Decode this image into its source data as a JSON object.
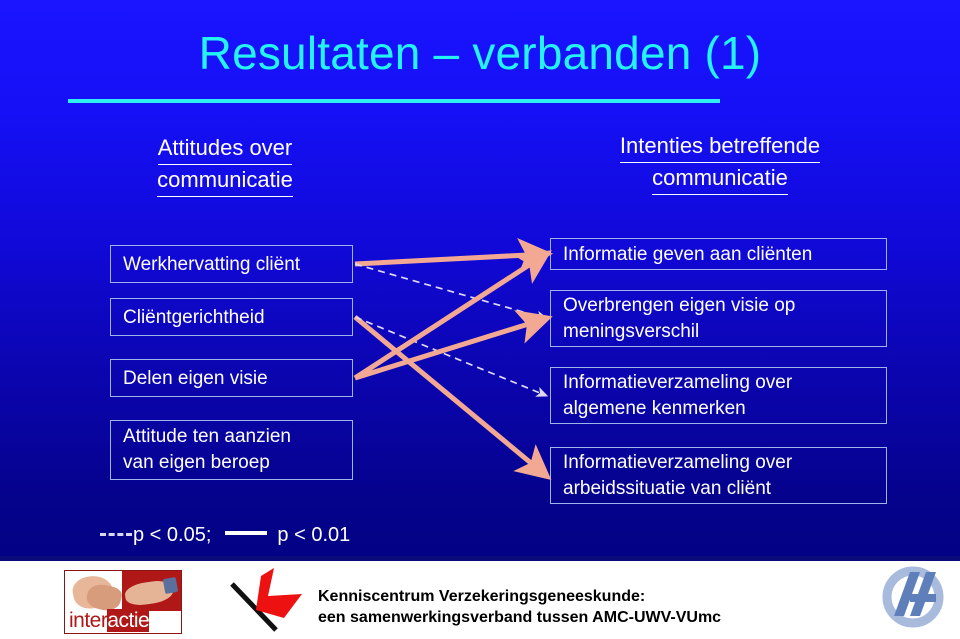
{
  "slide": {
    "title": "Resultaten – verbanden (1)",
    "title_color": "#25f3f3",
    "background_top_color": "#1a14ff",
    "background_bottom_color": "#000078"
  },
  "columns": {
    "left": {
      "heading_line1": "Attitudes over",
      "heading_line2": "communicatie",
      "boxes": [
        {
          "id": "werkhervatting",
          "text": "Werkhervatting cliënt"
        },
        {
          "id": "clientgerichtheid",
          "text": "Cliëntgerichtheid"
        },
        {
          "id": "delen-eigen-visie",
          "text": "Delen eigen visie"
        },
        {
          "id": "attitude-eigen-beroep",
          "line1": "Attitude ten aanzien",
          "line2": "van eigen beroep"
        }
      ]
    },
    "right": {
      "heading_line1": "Intenties betreffende",
      "heading_line2": "communicatie",
      "boxes": [
        {
          "id": "informatie-geven",
          "text": "Informatie geven aan cliënten"
        },
        {
          "id": "overbrengen-visie",
          "line1": "Overbrengen eigen visie op",
          "line2": "meningsverschil"
        },
        {
          "id": "verzameling-algemeen",
          "line1": "Informatieverzameling over",
          "line2": "algemene kenmerken"
        },
        {
          "id": "verzameling-arbeid",
          "line1": "Informatieverzameling over",
          "line2": "arbeidssituatie van cliënt"
        }
      ]
    }
  },
  "connections": {
    "solid_color": "#f2a893",
    "dashed_color": "#ded9f2",
    "links": [
      {
        "from": "werkhervatting",
        "to": "informatie-geven",
        "style": "solid",
        "significance": "p < 0.01"
      },
      {
        "from": "werkhervatting",
        "to": "overbrengen-visie",
        "style": "dashed",
        "significance": "p < 0.05"
      },
      {
        "from": "clientgerichtheid",
        "to": "verzameling-arbeid",
        "style": "solid",
        "significance": "p < 0.01"
      },
      {
        "from": "clientgerichtheid",
        "to": "verzameling-algemeen",
        "style": "dashed",
        "significance": "p < 0.05"
      },
      {
        "from": "delen-eigen-visie",
        "to": "informatie-geven",
        "style": "solid",
        "significance": "p < 0.01"
      },
      {
        "from": "delen-eigen-visie",
        "to": "overbrengen-visie",
        "style": "solid",
        "significance": "p < 0.01"
      }
    ]
  },
  "legend": {
    "dashed_label": "p < 0.05;",
    "solid_label": "p < 0.01"
  },
  "footer": {
    "line1": "Kenniscentrum Verzekeringsgeneeskunde:",
    "line2": "een samenwerkingsverband tussen AMC-UWV-VUmc",
    "logo_interactie_part1": "inter",
    "logo_interactie_part2": "actie"
  }
}
